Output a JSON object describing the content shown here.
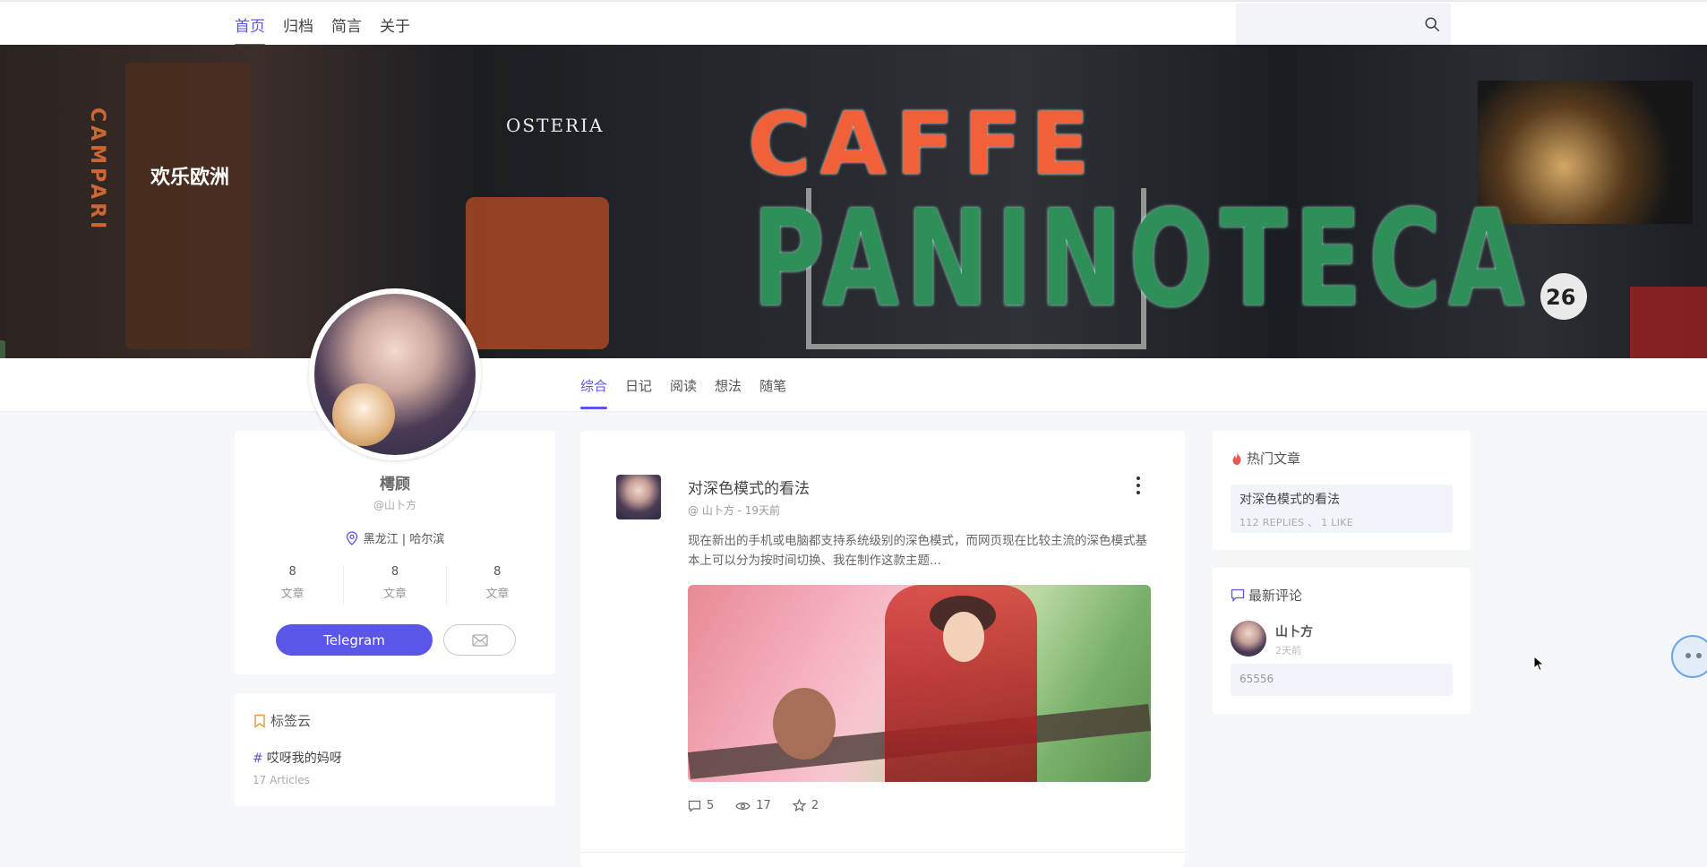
{
  "nav": {
    "items": [
      {
        "label": "首页",
        "active": true
      },
      {
        "label": "归档",
        "active": false
      },
      {
        "label": "简言",
        "active": false
      },
      {
        "label": "关于",
        "active": false
      }
    ]
  },
  "hero": {
    "sign_top": "CAFFE",
    "sign_bottom": "PANINOTECA",
    "sign_left": "OSTERIA",
    "sign_vertical": "CAMPARI",
    "sign_cn": "欢乐欧洲",
    "badge_number": "26"
  },
  "subtabs": [
    {
      "label": "综合",
      "active": true
    },
    {
      "label": "日记",
      "active": false
    },
    {
      "label": "阅读",
      "active": false
    },
    {
      "label": "想法",
      "active": false
    },
    {
      "label": "随笔",
      "active": false
    }
  ],
  "profile": {
    "name": "樗顾",
    "handle": "@山卜方",
    "location": "黑龙江 | 哈尔滨",
    "stats": [
      {
        "num": "8",
        "label": "文章"
      },
      {
        "num": "8",
        "label": "文章"
      },
      {
        "num": "8",
        "label": "文章"
      }
    ],
    "telegram_label": "Telegram"
  },
  "tags_card": {
    "title": "标签云",
    "tag": "哎呀我的妈呀",
    "count": "17 Articles"
  },
  "post": {
    "title": "对深色模式的看法",
    "meta": "@ 山卜方 - 19天前",
    "excerpt": "现在新出的手机或电脑都支持系统级别的深色模式，而网页现在比较主流的深色模式基本上可以分为按时间切换、我在制作这款主题...",
    "comments": "5",
    "views": "17",
    "stars": "2"
  },
  "hot": {
    "title": "热门文章",
    "item_title": "对深色模式的看法",
    "item_stats": "112 REPLIES 、 1 LIKE"
  },
  "latest_comments": {
    "title": "最新评论",
    "name": "山卜方",
    "time": "2天前",
    "body": "65556"
  },
  "colors": {
    "accent": "#5b56e8",
    "page_bg": "#f6f7fb",
    "hot_icon": "#e85a4f"
  }
}
